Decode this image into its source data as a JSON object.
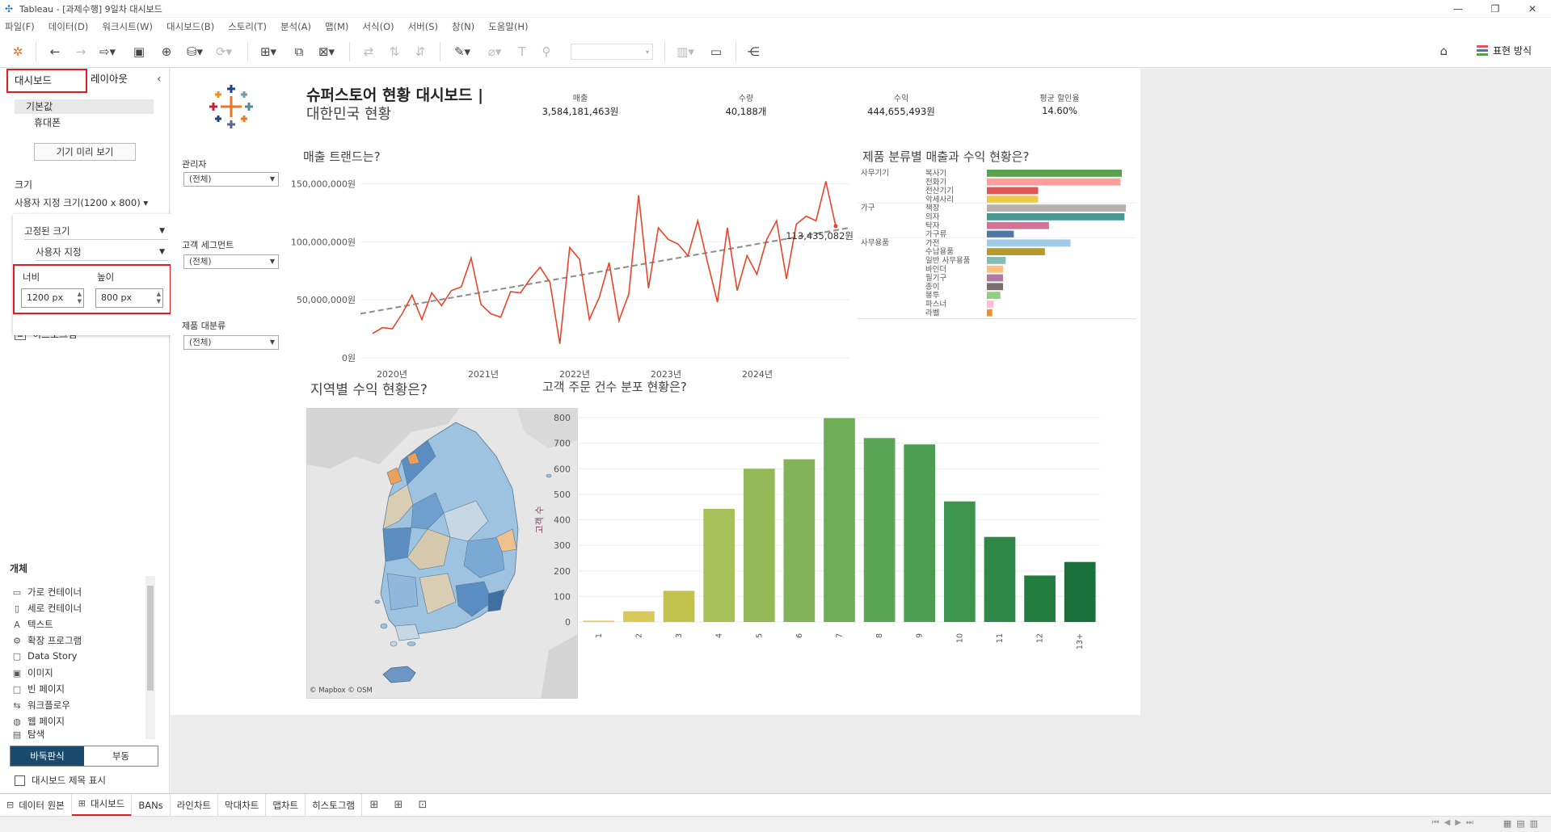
{
  "window": {
    "title": "Tableau - [과제수행] 9일차 대시보드",
    "controls": [
      "—",
      "❐",
      "✕"
    ]
  },
  "menu": [
    "파일(F)",
    "데이터(D)",
    "워크시트(W)",
    "대시보드(B)",
    "스토리(T)",
    "분석(A)",
    "맵(M)",
    "서식(O)",
    "서버(S)",
    "창(N)",
    "도움말(H)"
  ],
  "toolbar": {
    "show_me": "표현 방식"
  },
  "left_panel": {
    "tabs": [
      "대시보드",
      "레이아웃"
    ],
    "collapse": "‹",
    "devices": [
      "기본값",
      "휴대폰"
    ],
    "preview_button": "기기 미리 보기",
    "size_title": "크기",
    "size_value": "사용자 지정 크기(1200 x 800) ▾",
    "size_popup": {
      "range": "고정된 크기",
      "mode": "사용자 지정",
      "width_label": "너비",
      "height_label": "높이",
      "width_value": "1200 px",
      "height_value": "800 px"
    },
    "hist_item": "히스토그램",
    "objects_title": "개체",
    "objects": [
      {
        "icon": "▭",
        "label": "가로 컨테이너"
      },
      {
        "icon": "▯",
        "label": "세로 컨테이너"
      },
      {
        "icon": "A",
        "label": "텍스트"
      },
      {
        "icon": "⚙",
        "label": "확장 프로그램"
      },
      {
        "icon": "▢",
        "label": "Data Story"
      },
      {
        "icon": "▣",
        "label": "이미지"
      },
      {
        "icon": "□",
        "label": "빈 페이지"
      },
      {
        "icon": "⇆",
        "label": "워크플로우"
      },
      {
        "icon": "◍",
        "label": "웹 페이지"
      },
      {
        "icon": "▤",
        "label": "탐색"
      }
    ],
    "tiled": "바둑판식",
    "floating": "부동",
    "show_title": "대시보드 제목 표시"
  },
  "filters": [
    {
      "label": "관리자",
      "value": "(전체)"
    },
    {
      "label": "고객 세그먼트",
      "value": "(전체)"
    },
    {
      "label": "제품 대분류",
      "value": "(전체)"
    }
  ],
  "dashboard": {
    "title_line1": "슈퍼스토어 현황 대시보드 |",
    "title_line2": "대한민국 현황",
    "bans": [
      {
        "label": "매출",
        "value": "3,584,181,463원"
      },
      {
        "label": "수량",
        "value": "40,188개"
      },
      {
        "label": "수익",
        "value": "444,655,493원"
      },
      {
        "label": "평균 할인율",
        "value": "14.60%"
      }
    ],
    "line_title": "매출 트랜드는?",
    "bar_title": "제품 분류별 매출과 수익 현황은?",
    "map_title": "지역별 수익 현황은?",
    "map_credit": "© Mapbox © OSM",
    "hist_title": "고객 주문 건수 분포 현황은?"
  },
  "chart_data": [
    {
      "type": "line",
      "title": "매출 트랜드는?",
      "x_ticks": [
        "2020년",
        "2021년",
        "2022년",
        "2023년",
        "2024년"
      ],
      "y_ticks": [
        "0원",
        "50,000,000원",
        "100,000,000원",
        "150,000,000원"
      ],
      "ylim": [
        0,
        160000000
      ],
      "series": [
        {
          "color": "#e8452b",
          "values": [
            21000000,
            26000000,
            25000000,
            38000000,
            54000000,
            33000000,
            56000000,
            45000000,
            58000000,
            61000000,
            86000000,
            46000000,
            38000000,
            35000000,
            57000000,
            56000000,
            68000000,
            78000000,
            65000000,
            12000000,
            95000000,
            85000000,
            33000000,
            52000000,
            82000000,
            32000000,
            55000000,
            140000000,
            60000000,
            112000000,
            102000000,
            98000000,
            88000000,
            118000000,
            82000000,
            48000000,
            112000000,
            58000000,
            88000000,
            72000000,
            102000000,
            118000000,
            68000000,
            115000000,
            122000000,
            118000000,
            152000000,
            113435082
          ]
        }
      ],
      "trend": {
        "start": 38000000,
        "end": 112000000,
        "color": "#8c8c8c"
      },
      "annotation": "113,435,082원"
    },
    {
      "type": "bar",
      "title": "제품 분류별 매출과 수익 현황은?",
      "groups": [
        "사무기기",
        "가구",
        "사무용품"
      ],
      "categories": [
        {
          "group": "사무기기",
          "name": "복사기",
          "value": 100,
          "color": "#59a14f"
        },
        {
          "group": "사무기기",
          "name": "전화기",
          "value": 99,
          "color": "#ff9d9a"
        },
        {
          "group": "사무기기",
          "name": "전산기기",
          "value": 38,
          "color": "#e15759"
        },
        {
          "group": "사무기기",
          "name": "악세사리",
          "value": 38,
          "color": "#edc948"
        },
        {
          "group": "가구",
          "name": "책장",
          "value": 103,
          "color": "#bab0ac"
        },
        {
          "group": "가구",
          "name": "의자",
          "value": 102,
          "color": "#499894"
        },
        {
          "group": "가구",
          "name": "탁자",
          "value": 46,
          "color": "#d37295"
        },
        {
          "group": "가구",
          "name": "가구류",
          "value": 20,
          "color": "#4e79a7"
        },
        {
          "group": "사무용품",
          "name": "가전",
          "value": 62,
          "color": "#a0cbe8"
        },
        {
          "group": "사무용품",
          "name": "수납용품",
          "value": 43,
          "color": "#b6992d"
        },
        {
          "group": "사무용품",
          "name": "일반 사무용품",
          "value": 14,
          "color": "#86bcb6"
        },
        {
          "group": "사무용품",
          "name": "바인더",
          "value": 12,
          "color": "#ffbe7d"
        },
        {
          "group": "사무용품",
          "name": "필기구",
          "value": 12,
          "color": "#b07aa1"
        },
        {
          "group": "사무용품",
          "name": "종이",
          "value": 12,
          "color": "#79706e"
        },
        {
          "group": "사무용품",
          "name": "봉투",
          "value": 10,
          "color": "#8cd17d"
        },
        {
          "group": "사무용품",
          "name": "파스너",
          "value": 5,
          "color": "#fabfd2"
        },
        {
          "group": "사무용품",
          "name": "라벨",
          "value": 4,
          "color": "#f28e2b"
        }
      ]
    },
    {
      "type": "bar",
      "title": "고객 주문 건수 분포 현황은?",
      "ylabel": "고객 수",
      "categories": [
        "1",
        "2",
        "3",
        "4",
        "5",
        "6",
        "7",
        "8",
        "9",
        "10",
        "11",
        "12",
        "13+"
      ],
      "values": [
        5,
        42,
        122,
        443,
        600,
        637,
        798,
        720,
        695,
        472,
        333,
        182,
        235
      ],
      "colors": [
        "#e3c94a",
        "#d9c959",
        "#c2c24f",
        "#a8c05a",
        "#92b956",
        "#82b25a",
        "#6ead58",
        "#5aa556",
        "#4c9d52",
        "#3d944d",
        "#2f8747",
        "#237c40",
        "#19703a"
      ],
      "y_ticks": [
        "0",
        "100",
        "200",
        "300",
        "400",
        "500",
        "600",
        "700",
        "800"
      ],
      "ylim": [
        0,
        800
      ]
    }
  ],
  "sheet_tabs": [
    {
      "icon": "⊟",
      "label": "데이터 원본"
    },
    {
      "icon": "⊞",
      "label": "대시보드"
    },
    {
      "icon": "",
      "label": "BANs"
    },
    {
      "icon": "",
      "label": "라인차트"
    },
    {
      "icon": "",
      "label": "막대차트"
    },
    {
      "icon": "",
      "label": "맵차트"
    },
    {
      "icon": "",
      "label": "히스토그램"
    }
  ]
}
